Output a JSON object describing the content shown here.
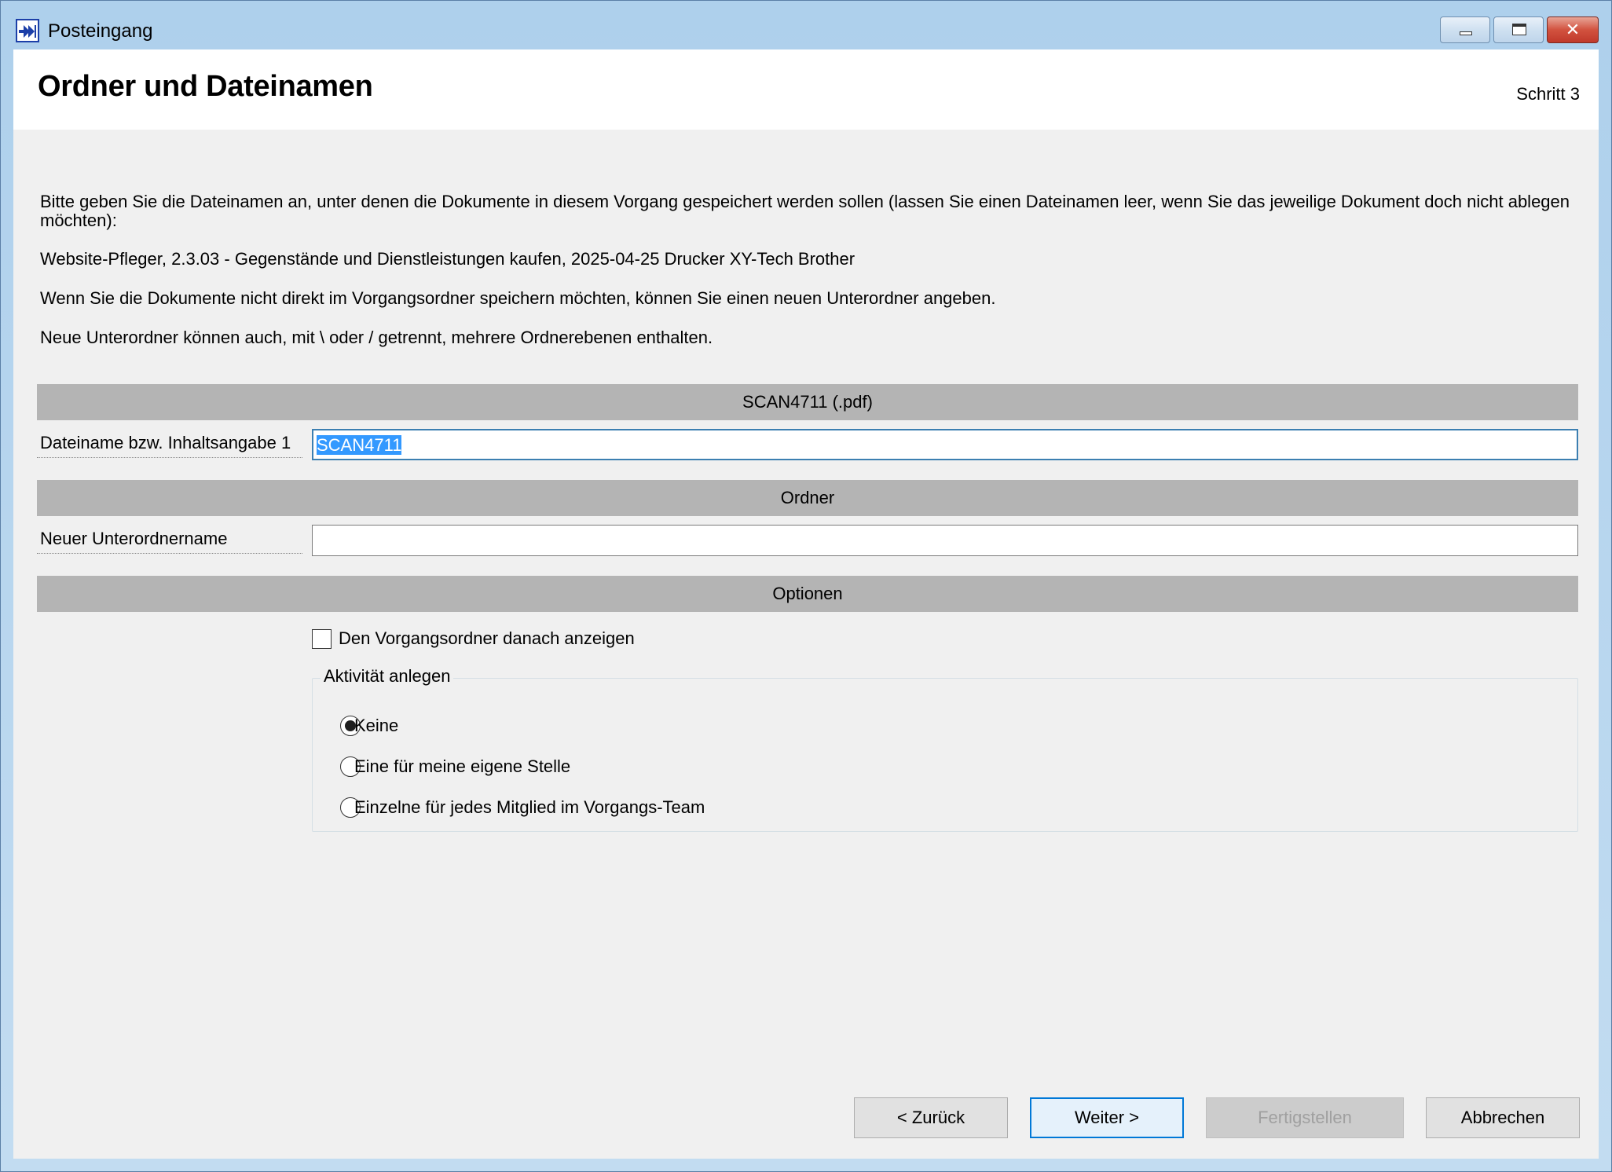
{
  "window": {
    "title": "Posteingang",
    "icon": "arrow-inbox-icon"
  },
  "header": {
    "title": "Ordner und Dateinamen",
    "step": "Schritt 3"
  },
  "instructions": {
    "line1": "Bitte geben Sie die Dateinamen an, unter denen die Dokumente in diesem Vorgang gespeichert werden sollen (lassen Sie einen Dateinamen leer, wenn Sie das jeweilige Dokument doch nicht ablegen möchten):",
    "line2": "Website-Pfleger, 2.3.03 - Gegenstände und Dienstleistungen kaufen, 2025-04-25 Drucker XY-Tech Brother",
    "line3": "Wenn Sie die Dokumente nicht direkt im Vorgangsordner speichern möchten, können Sie einen neuen Unterordner angeben.",
    "line4": "Neue Unterordner können auch, mit \\ oder / getrennt, mehrere Ordnerebenen enthalten."
  },
  "sections": {
    "file": "SCAN4711 (.pdf)",
    "folder": "Ordner",
    "options": "Optionen"
  },
  "fields": {
    "filename_label": "Dateiname bzw. Inhaltsangabe 1",
    "filename_value": "SCAN4711",
    "subfolder_label": "Neuer Unterordnername",
    "subfolder_value": ""
  },
  "options": {
    "show_folder_label": "Den Vorgangsordner danach anzeigen",
    "show_folder_checked": false,
    "activity_group_title": "Aktivität anlegen",
    "radio_none": "Keine",
    "radio_own": "Eine für meine eigene Stelle",
    "radio_team": "Einzelne für jedes Mitglied im Vorgangs-Team",
    "selected": "Keine"
  },
  "buttons": {
    "back": "< Zurück",
    "next": "Weiter >",
    "finish": "Fertigstellen",
    "cancel": "Abbrechen"
  },
  "colors": {
    "section_bar": "#b4b4b4",
    "selection": "#3399ff",
    "focus_border": "#0078d7"
  }
}
